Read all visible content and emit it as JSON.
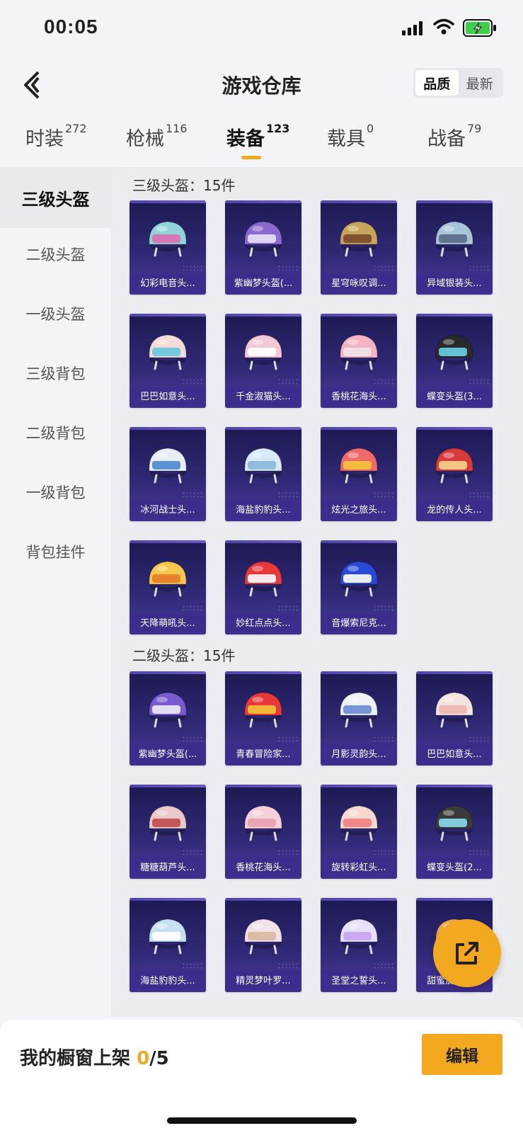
{
  "status_bar": {
    "time": "00:05"
  },
  "header": {
    "title": "游戏仓库",
    "sort_options": [
      "品质",
      "最新"
    ],
    "sort_selected": "品质"
  },
  "tabs": [
    {
      "label": "时装",
      "count": "272"
    },
    {
      "label": "枪械",
      "count": "116"
    },
    {
      "label": "装备",
      "count": "123"
    },
    {
      "label": "载具",
      "count": "0"
    },
    {
      "label": "战备",
      "count": "79"
    }
  ],
  "active_tab": "装备",
  "sidebar": [
    "三级头盔",
    "二级头盔",
    "一级头盔",
    "三级背包",
    "二级背包",
    "一级背包",
    "背包挂件"
  ],
  "active_sidebar": "三级头盔",
  "sections": [
    {
      "title": "三级头盔：15件",
      "items": [
        "幻彩电音头...",
        "紫幽梦头盔(...",
        "星穹咏叹调...",
        "异域银装头...",
        "巴巴如意头...",
        "千金淑猫头...",
        "香桃花海头...",
        "蝶变头盔(3...",
        "冰河战士头...",
        "海盐豹豹头...",
        "炫光之旅头...",
        "龙的传人头...",
        "天降萌吼头...",
        "妙红点点头...",
        "音爆索尼克..."
      ]
    },
    {
      "title": "二级头盔：15件",
      "items": [
        "紫幽梦头盔(...",
        "青春冒险家...",
        "月影灵韵头...",
        "巴巴如意头...",
        "糖糖葫芦头...",
        "香桃花海头...",
        "旋转彩虹头...",
        "蝶变头盔(2...",
        "海盐豹豹头...",
        "精灵梦叶罗...",
        "圣堂之誓头...",
        "甜蜜旋律头..."
      ]
    }
  ],
  "bottom_bar": {
    "label": "我的橱窗上架",
    "current": "0",
    "total": "/5",
    "edit_label": "编辑"
  },
  "colors": {
    "accent": "#f3a91f",
    "card_bg": "#2a2570"
  },
  "helmet_colors": [
    [
      "#8fd4d8",
      "#e06ab0"
    ],
    [
      "#8a6ad0",
      "#e8e2f6"
    ],
    [
      "#c8a45a",
      "#7a4a2a"
    ],
    [
      "#a8c4d8",
      "#5a6a88"
    ],
    [
      "#f3dcd8",
      "#66c8e0"
    ],
    [
      "#f2c8d6",
      "#ffffff"
    ],
    [
      "#f4b4c4",
      "#f0e4e8"
    ],
    [
      "#2a2a2a",
      "#6ad0e8"
    ],
    [
      "#e8eef8",
      "#4a8ad0"
    ],
    [
      "#d8eaf8",
      "#88b8d8"
    ],
    [
      "#f06a6a",
      "#f4c43a"
    ],
    [
      "#d83a3a",
      "#f4d48a"
    ],
    [
      "#f4c84a",
      "#e87a2a"
    ],
    [
      "#e83a3a",
      "#ffffff"
    ],
    [
      "#2a4ad8",
      "#ffffff"
    ],
    [
      "#7a5ad0",
      "#f0ecf8"
    ],
    [
      "#e83a3a",
      "#f4c43a"
    ],
    [
      "#eef0f8",
      "#6a8ad0"
    ],
    [
      "#f4e4e0",
      "#f0b8b0"
    ],
    [
      "#e8c8c8",
      "#c04a4a"
    ],
    [
      "#f4d0d8",
      "#e8a0b0"
    ],
    [
      "#f4d8d0",
      "#f08080"
    ],
    [
      "#3a3a3a",
      "#8adcf0"
    ],
    [
      "#c8e0f4",
      "#ffffff"
    ],
    [
      "#f0e0e8",
      "#d8b8a0"
    ],
    [
      "#e8e0f8",
      "#c8a4f0"
    ],
    [
      "#f4a84a",
      "#f4a84a"
    ]
  ]
}
